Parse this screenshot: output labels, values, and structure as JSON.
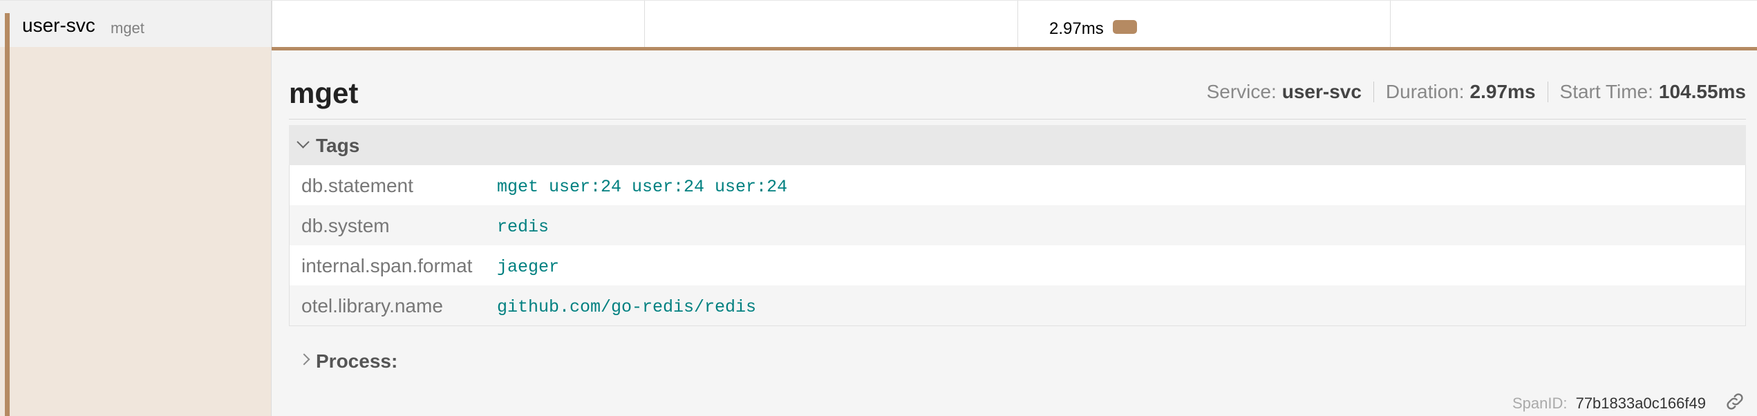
{
  "span_row": {
    "service": "user-svc",
    "operation": "mget",
    "duration_label": "2.97ms",
    "service_color": "#b58a62"
  },
  "detail": {
    "title": "mget",
    "overview": {
      "service_label": "Service:",
      "service_value": "user-svc",
      "duration_label": "Duration:",
      "duration_value": "2.97ms",
      "start_label": "Start Time:",
      "start_value": "104.55ms"
    },
    "tags": {
      "title": "Tags",
      "rows": [
        {
          "key": "db.statement",
          "value": "mget user:24 user:24 user:24"
        },
        {
          "key": "db.system",
          "value": "redis"
        },
        {
          "key": "internal.span.format",
          "value": "jaeger"
        },
        {
          "key": "otel.library.name",
          "value": "github.com/go-redis/redis"
        }
      ]
    },
    "process": {
      "title": "Process:"
    },
    "span_id": {
      "label": "SpanID:",
      "value": "77b1833a0c166f49"
    }
  },
  "icons": {
    "tags_toggle": "chevron-down-icon",
    "process_toggle": "chevron-right-icon",
    "span_link": "link-icon"
  }
}
